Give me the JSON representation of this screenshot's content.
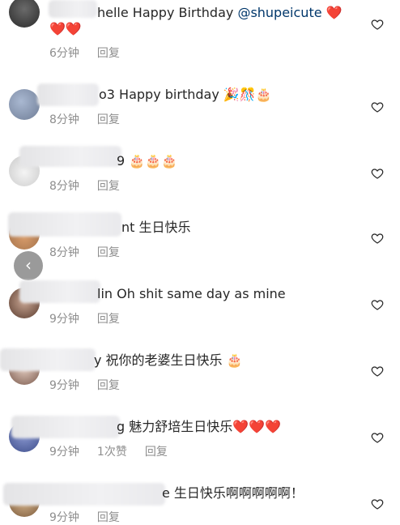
{
  "comments": [
    {
      "name_tail": "helle",
      "text": " Happy Birthday ",
      "mention": "@shupeicute",
      "emoji": "❤️",
      "emoji2": "❤️❤️",
      "time": "6分钟",
      "reply": "回复"
    },
    {
      "name_tail": "o3",
      "text": " Happy birthday ",
      "emoji": "🎉🎊🎂",
      "time": "8分钟",
      "reply": "回复"
    },
    {
      "name_tail": "9",
      "text": " ",
      "emoji": "🎂🎂🎂",
      "time": "8分钟",
      "reply": "回复"
    },
    {
      "name_tail": "nt",
      "text": " 生日快乐",
      "emoji": "",
      "time": "8分钟",
      "reply": "回复"
    },
    {
      "name_tail": "lin",
      "text": " Oh shit same day as mine",
      "emoji": "",
      "time": "9分钟",
      "reply": "回复"
    },
    {
      "name_tail": "y",
      "text": " 祝你的老婆生日快乐 ",
      "emoji": "🎂",
      "time": "9分钟",
      "reply": "回复"
    },
    {
      "name_tail": "g",
      "text": " 魅力舒培生日快乐",
      "emoji": "❤️❤️❤️",
      "time": "9分钟",
      "likes": "1次赞",
      "reply": "回复"
    },
    {
      "name_tail": "e",
      "text": " 生日快乐啊啊啊啊啊！",
      "emoji": "",
      "time": "9分钟",
      "reply": "回复"
    }
  ],
  "back_button": "‹",
  "colors": {
    "muted": "#8e8e8e",
    "mention": "#00376b"
  }
}
